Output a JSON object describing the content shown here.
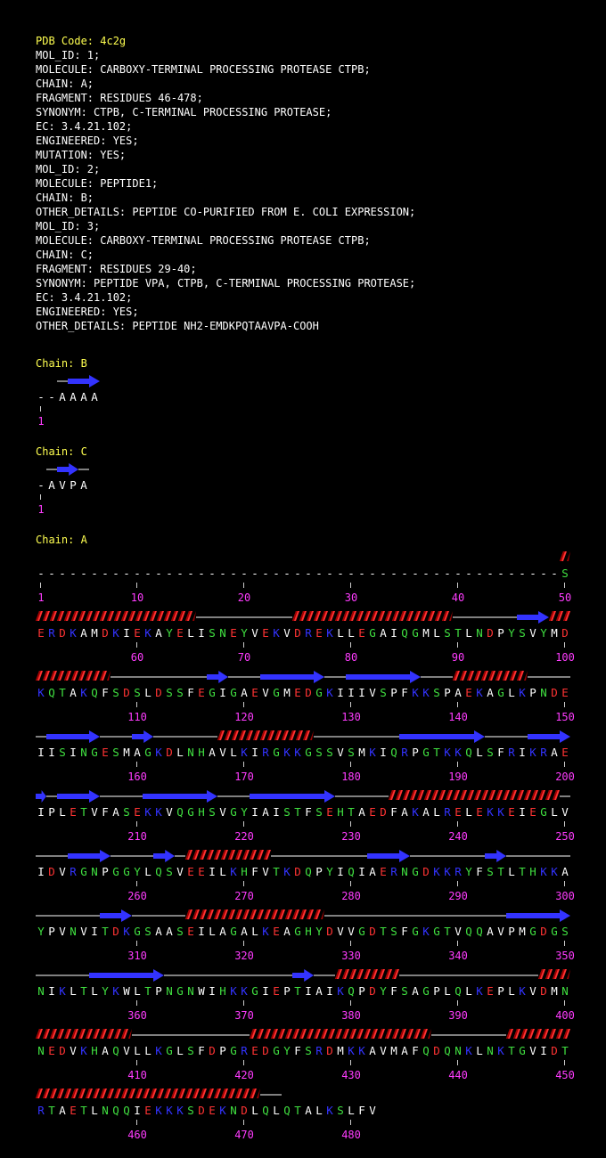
{
  "colors": {
    "background": "#000000",
    "header_title": "#ffff50",
    "text": "#ffffff",
    "helix": "#ff3333",
    "strand": "#3333ff",
    "coil": "#ffffff",
    "number": "#ff3cff",
    "acidic": "#ff3333",
    "basic": "#3333ff",
    "polar": "#40e040",
    "hydrophobic": "#ffffff"
  },
  "header": {
    "pdb_code": "PDB Code: 4c2g",
    "lines": [
      "MOL_ID: 1;",
      "MOLECULE: CARBOXY-TERMINAL PROCESSING PROTEASE CTPB;",
      "CHAIN: A;",
      "FRAGMENT: RESIDUES 46-478;",
      "SYNONYM: CTPB, C-TERMINAL PROCESSING PROTEASE;",
      "EC: 3.4.21.102;",
      "ENGINEERED: YES;",
      "MUTATION: YES;",
      "MOL_ID: 2;",
      "MOLECULE: PEPTIDE1;",
      "CHAIN: B;",
      "OTHER_DETAILS: PEPTIDE CO-PURIFIED FROM E. COLI EXPRESSION;",
      "MOL_ID: 3;",
      "MOLECULE: CARBOXY-TERMINAL PROCESSING PROTEASE CTPB;",
      "CHAIN: C;",
      "FRAGMENT: RESIDUES 29-40;",
      "SYNONYM: PEPTIDE VPA, CTPB, C-TERMINAL PROCESSING PROTEASE;",
      "EC: 3.4.21.102;",
      "ENGINEERED: YES;",
      "OTHER_DETAILS: PEPTIDE NH2-EMDKPQTAAVPA-COOH"
    ]
  },
  "chains": [
    {
      "title": "Chain: B",
      "start": 1,
      "sequence": "--AAAA",
      "ss": "  -EEE"
    },
    {
      "title": "Chain: C",
      "start": 1,
      "sequence": "-AVPA",
      "ss": " -EE-"
    },
    {
      "title": "Chain: A",
      "start": 1,
      "sequence": "-------------------------------------------------SERDKAMDKIEKAYELISNEYVEKVDREKLLEGAIQGMLSTLNDPYSVYMDKQTAKQFSDSLDSSFEGIGAEVGMEDGKIIIVSPFKKSPAEKAGLKPNDEIISINGESMAGKDLNHAVLKIRGKKGSSVSMKIQRPGTKKQLSFRIKRAEIPLETVFASEKKVQGHSVGYIAISTFSEHTAEDFAKALRELEKKEIEGLVIDVRGNPGGYLQSVEEILKHFVTKDQPYIQIAERNGDKKRYFSTLTHKKAYPVNVITDKGSAASEILAGALKEAGHYDVVGDTSFGKGTVQQAVPMGDGSNIKLTLYKWLTPNGNWIHKKGIEPTIAIKQPDYFSAGPLQLKEPLKVDMNNEDVKHAQVLLKGLSFDPGREDGYFSRDMKKAVMAFQDQNKLNKTGVIDTRTAETLNQQIEKKKSDEKNDLQLQTALKSLFV",
      "ss": "                                                 HHHHHHHHHHHHHHHH---------HHHHHHHHHHHHHHH------EEEHHHHHHHHH---------EE---EEEEEE--EEEEEEE---HHHHHHH-----EEEEE---EE------HHHHHHHHH--------EEEEEEEE----EEEEE-EEEE----EEEEEEE---EEEEEEEE-----HHHHHHHHHHHHHHHH----EEEE----EE-HHHHHHHH---------EEEE-------EE------------EEE-----HHHHHHHHHHHHH-----------------EEEEEE-----EEEEEEE------------EE--HHHHHH-------------HHHHHHHHHHHH-----------HHHHHHHHHHHHHHHHH-------HHHHHHHHHHHHHHHHHHHHHHHHHHH--"
    }
  ]
}
